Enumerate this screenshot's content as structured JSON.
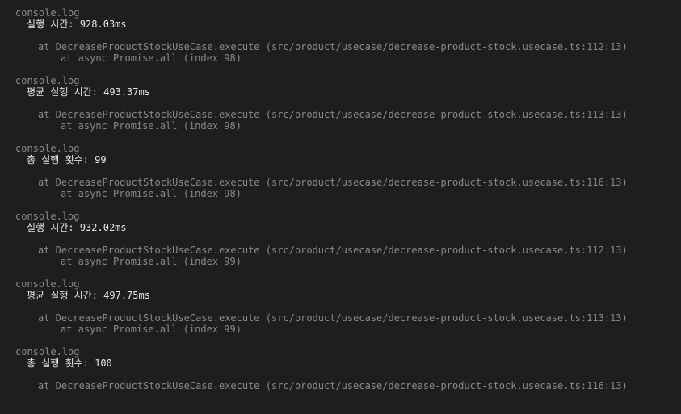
{
  "console": {
    "entries": [
      {
        "header": "console.log",
        "message": "실행 시간: 928.03ms",
        "trace": "at DecreaseProductStockUseCase.execute (src/product/usecase/decrease-product-stock.usecase.ts:112:13)",
        "async": "at async Promise.all (index 98)"
      },
      {
        "header": "console.log",
        "message": "평균 실행 시간: 493.37ms",
        "trace": "at DecreaseProductStockUseCase.execute (src/product/usecase/decrease-product-stock.usecase.ts:113:13)",
        "async": "at async Promise.all (index 98)"
      },
      {
        "header": "console.log",
        "message": "총 실행 횟수: 99",
        "trace": "at DecreaseProductStockUseCase.execute (src/product/usecase/decrease-product-stock.usecase.ts:116:13)",
        "async": "at async Promise.all (index 98)"
      },
      {
        "header": "console.log",
        "message": "실행 시간: 932.02ms",
        "trace": "at DecreaseProductStockUseCase.execute (src/product/usecase/decrease-product-stock.usecase.ts:112:13)",
        "async": "at async Promise.all (index 99)"
      },
      {
        "header": "console.log",
        "message": "평균 실행 시간: 497.75ms",
        "trace": "at DecreaseProductStockUseCase.execute (src/product/usecase/decrease-product-stock.usecase.ts:113:13)",
        "async": "at async Promise.all (index 99)"
      },
      {
        "header": "console.log",
        "message": "총 실행 횟수: 100",
        "trace": "at DecreaseProductStockUseCase.execute (src/product/usecase/decrease-product-stock.usecase.ts:116:13)",
        "async": ""
      }
    ]
  },
  "colors": {
    "background": "#1e1e1e",
    "header_text": "#8a8a8a",
    "message_text": "#e6e6e6",
    "trace_text": "#8a8a8a"
  }
}
